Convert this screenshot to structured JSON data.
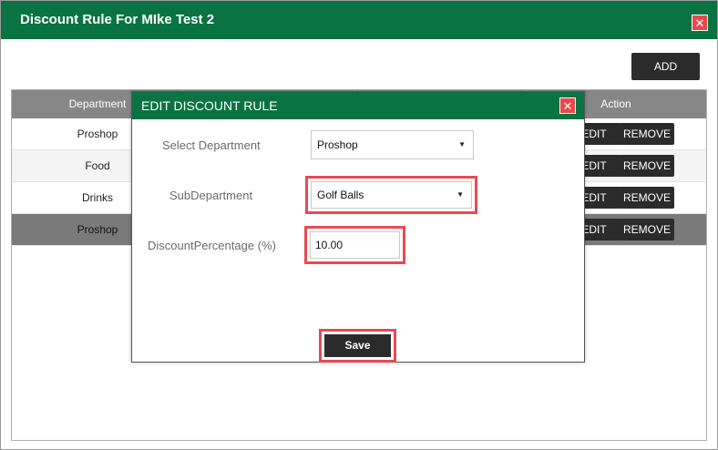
{
  "window": {
    "title": "Discount Rule For MIke Test 2",
    "close_glyph": "✕"
  },
  "toolbar": {
    "add_label": "ADD"
  },
  "grid": {
    "columns": [
      "Department",
      "Action"
    ],
    "rows": [
      {
        "department": "Proshop",
        "edit_label": "EDIT",
        "remove_label": "REMOVE"
      },
      {
        "department": "Food",
        "edit_label": "EDIT",
        "remove_label": "REMOVE"
      },
      {
        "department": "Drinks",
        "edit_label": "EDIT",
        "remove_label": "REMOVE"
      },
      {
        "department": "Proshop",
        "edit_label": "EDIT",
        "remove_label": "REMOVE"
      }
    ]
  },
  "modal": {
    "title": "EDIT DISCOUNT RULE",
    "close_glyph": "✕",
    "select_department_label": "Select Department",
    "department_value": "Proshop",
    "subdepartment_label": "SubDepartment",
    "subdepartment_value": "Golf Balls",
    "discount_label": "DiscountPercentage (%)",
    "discount_value": "10.00",
    "save_label": "Save",
    "dropdown_arrow": "▼"
  },
  "colors": {
    "header_green": "#0a7342",
    "highlight_red": "#e94a52",
    "button_dark": "#2b2b2b",
    "grid_header": "#878787",
    "selected_row": "#7a7a7a"
  }
}
